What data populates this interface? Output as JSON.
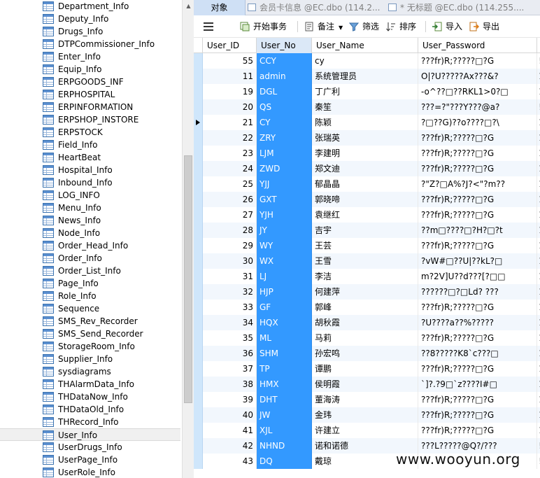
{
  "tree": {
    "items": [
      {
        "label": "Department_Info"
      },
      {
        "label": "Deputy_Info"
      },
      {
        "label": "Drugs_Info"
      },
      {
        "label": "DTPCommissioner_Info"
      },
      {
        "label": "Enter_Info"
      },
      {
        "label": "Equip_Info"
      },
      {
        "label": "ERPGOODS_INF"
      },
      {
        "label": "ERPHOSPITAL"
      },
      {
        "label": "ERPINFORMATION"
      },
      {
        "label": "ERPSHOP_INSTORE"
      },
      {
        "label": "ERPSTOCK"
      },
      {
        "label": "Field_Info"
      },
      {
        "label": "HeartBeat"
      },
      {
        "label": "Hospital_Info"
      },
      {
        "label": "Inbound_Info"
      },
      {
        "label": "LOG_INFO"
      },
      {
        "label": "Menu_Info"
      },
      {
        "label": "News_Info"
      },
      {
        "label": "Node_Info"
      },
      {
        "label": "Order_Head_Info"
      },
      {
        "label": "Order_Info"
      },
      {
        "label": "Order_List_Info"
      },
      {
        "label": "Page_Info"
      },
      {
        "label": "Role_Info"
      },
      {
        "label": "Sequence"
      },
      {
        "label": "SMS_Rev_Recorder"
      },
      {
        "label": "SMS_Send_Recorder"
      },
      {
        "label": "StorageRoom_Info"
      },
      {
        "label": "Supplier_Info"
      },
      {
        "label": "sysdiagrams"
      },
      {
        "label": "THAlarmData_Info"
      },
      {
        "label": "THDataNow_Info"
      },
      {
        "label": "THDataOld_Info"
      },
      {
        "label": "THRecord_Info"
      },
      {
        "label": "User_Info"
      },
      {
        "label": "UserDrugs_Info"
      },
      {
        "label": "UserPage_Info"
      },
      {
        "label": "UserRole_Info"
      }
    ],
    "selected_index": 34
  },
  "tabs": [
    {
      "label": "对象"
    },
    {
      "label": "会员卡信息 @EC.dbo (114.2..."
    },
    {
      "label": "* 无标题 @EC.dbo (114.255...."
    }
  ],
  "toolbar": {
    "begin_tx": "开始事务",
    "memo": "备注",
    "filter": "筛选",
    "sort": "排序",
    "import": "导入",
    "export": "导出"
  },
  "columns": [
    "User_ID",
    "User_No",
    "User_Name",
    "User_Password"
  ],
  "rows": [
    {
      "id": "55",
      "no": "CCY",
      "name": "cy",
      "pwd": "???fr)R;?????□?G"
    },
    {
      "id": "11",
      "no": "admin",
      "name": "系统管理员",
      "pwd": "O|?U?????Ax???&?"
    },
    {
      "id": "19",
      "no": "DGL",
      "name": "丁广利",
      "pwd": "-o^??□??RKL1>0?□"
    },
    {
      "id": "20",
      "no": "QS",
      "name": "秦笙",
      "pwd": "???=?\"???Y???@a?"
    },
    {
      "id": "21",
      "no": "CY",
      "name": "陈颖",
      "pwd": "?□??G)??o????□?\\"
    },
    {
      "id": "22",
      "no": "ZRY",
      "name": "张瑞英",
      "pwd": "???fr)R;?????□?G"
    },
    {
      "id": "23",
      "no": "LJM",
      "name": "李建明",
      "pwd": "???fr)R;?????□?G"
    },
    {
      "id": "24",
      "no": "ZWD",
      "name": "郑文迪",
      "pwd": "???fr)R;?????□?G"
    },
    {
      "id": "25",
      "no": "YJJ",
      "name": "郁晶晶",
      "pwd": "?\"Z?□A%?J?<\"?m??"
    },
    {
      "id": "26",
      "no": "GXT",
      "name": "郭晓啼",
      "pwd": "???fr)R;?????□?G"
    },
    {
      "id": "27",
      "no": "YJH",
      "name": "袁继红",
      "pwd": "???fr)R;?????□?G"
    },
    {
      "id": "28",
      "no": "JY",
      "name": "吉宇",
      "pwd": "??m□????□?H?□?t"
    },
    {
      "id": "29",
      "no": "WY",
      "name": "王芸",
      "pwd": "???fr)R;?????□?G"
    },
    {
      "id": "30",
      "no": "WX",
      "name": "王雪",
      "pwd": "?vW#□??U|??kL?□"
    },
    {
      "id": "31",
      "no": "LJ",
      "name": "李洁",
      "pwd": "m?2V]U??d???[?□□"
    },
    {
      "id": "32",
      "no": "HJP",
      "name": "何建萍",
      "pwd": "??????□?□Ld? ???"
    },
    {
      "id": "33",
      "no": "GF",
      "name": "郭峰",
      "pwd": "???fr)R;?????□?G"
    },
    {
      "id": "34",
      "no": "HQX",
      "name": "胡秋霞",
      "pwd": "?U????a??%?????"
    },
    {
      "id": "35",
      "no": "ML",
      "name": "马莉",
      "pwd": "???fr)R;?????□?G"
    },
    {
      "id": "36",
      "no": "SHM",
      "name": "孙宏鸣",
      "pwd": "??8?????K8`c???□"
    },
    {
      "id": "37",
      "no": "TP",
      "name": "谭鹏",
      "pwd": "???fr)R;?????□?G"
    },
    {
      "id": "38",
      "no": "HMX",
      "name": "侯明霞",
      "pwd": "`]?.?9□`z????I#□"
    },
    {
      "id": "39",
      "no": "DHT",
      "name": "董海涛",
      "pwd": "???fr)R;?????□?G"
    },
    {
      "id": "40",
      "no": "JW",
      "name": "金玮",
      "pwd": "???fr)R;?????□?G"
    },
    {
      "id": "41",
      "no": "XJL",
      "name": "许建立",
      "pwd": "???fr)R;?????□?G"
    },
    {
      "id": "42",
      "no": "NHND",
      "name": "诺和诺德",
      "pwd": "???L?????@Q?/???"
    },
    {
      "id": "43",
      "no": "DQ",
      "name": "戴琼",
      "pwd": ""
    }
  ],
  "current_row_index": 4,
  "row_more_glyphs": [
    "!",
    "1",
    "1",
    "!",
    "1",
    "1",
    "1",
    "1",
    "1",
    "1",
    "1",
    "1",
    "1",
    "1",
    "1",
    "1",
    "1",
    "1",
    "1",
    "1",
    "1",
    "1",
    "1",
    "1",
    "1",
    "!",
    "!"
  ],
  "watermark": "www.wooyun.org",
  "colors": {
    "selected_column": "#3399ff",
    "row_indicator": "#cfe6fb",
    "active_tab": "#cfe0f5"
  }
}
